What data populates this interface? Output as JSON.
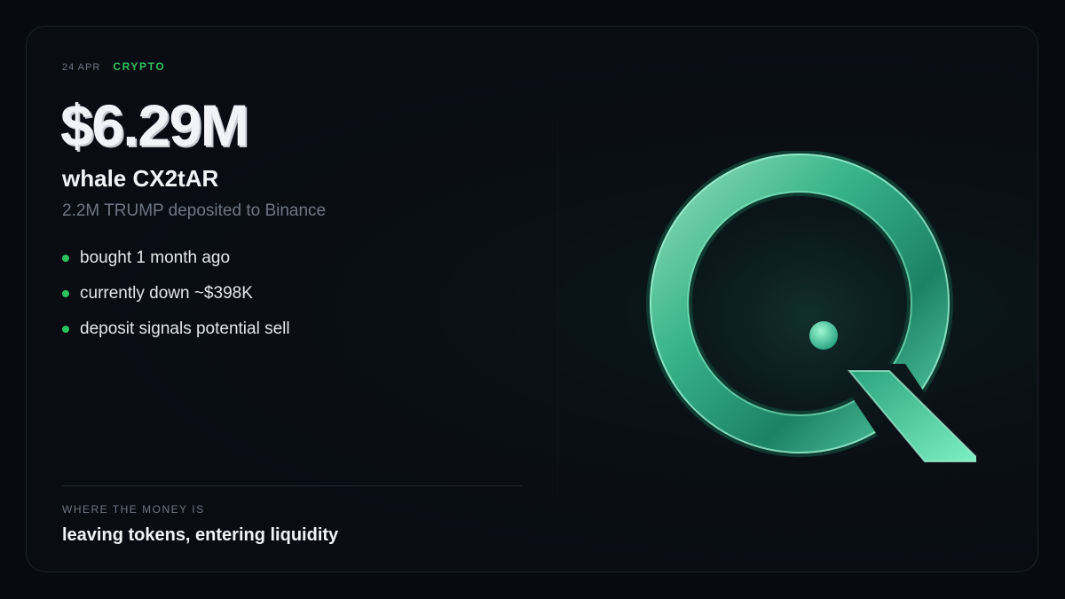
{
  "meta": {
    "date": "24 APR",
    "category": "CRYPTO"
  },
  "headline": {
    "amount": "$6.29M",
    "subject": "whale CX2tAR",
    "detail": "2.2M TRUMP deposited to Binance"
  },
  "bullets": [
    "bought 1 month ago",
    "currently down ~$398K",
    "deposit signals potential sell"
  ],
  "footer": {
    "label": "WHERE THE MONEY IS",
    "text": "leaving tokens, entering liquidity"
  },
  "colors": {
    "accent": "#2bc35e",
    "logo": "#3fd9a0",
    "background": "#070a10"
  },
  "logo": {
    "icon": "q-logo-icon"
  }
}
